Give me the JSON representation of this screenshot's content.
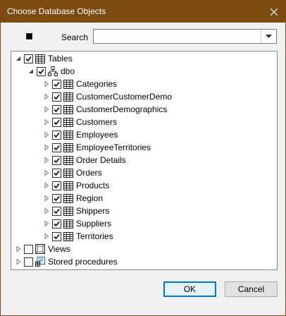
{
  "window": {
    "title": "Choose Database Objects"
  },
  "search": {
    "label": "Search",
    "value": ""
  },
  "tree": {
    "root": {
      "label": "Tables",
      "expanded": true,
      "checked": true
    },
    "schema": {
      "label": "dbo",
      "expanded": true,
      "checked": true
    },
    "tables": [
      "Categories",
      "CustomerCustomerDemo",
      "CustomerDemographics",
      "Customers",
      "Employees",
      "EmployeeTerritories",
      "Order Details",
      "Orders",
      "Products",
      "Region",
      "Shippers",
      "Suppliers",
      "Territories"
    ],
    "views": {
      "label": "Views",
      "checked": false
    },
    "procedures": {
      "label": "Stored procedures",
      "checked": false
    }
  },
  "buttons": {
    "ok": "OK",
    "cancel": "Cancel"
  },
  "colors": {
    "titlebar": "#7b4b0f",
    "accent": "#0078d7"
  }
}
